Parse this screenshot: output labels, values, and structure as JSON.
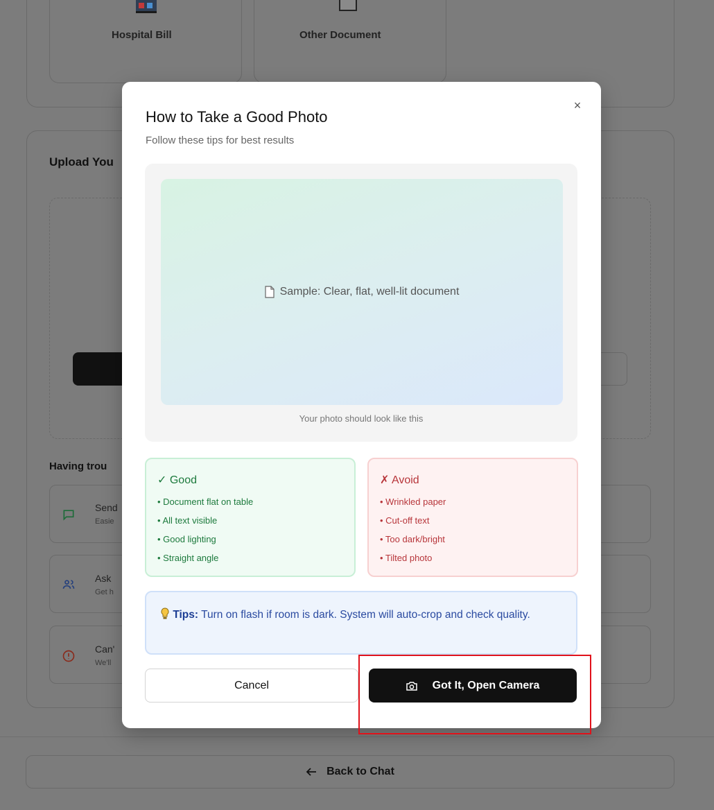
{
  "background": {
    "doc_types": [
      {
        "label": "Hospital Bill"
      },
      {
        "label": "Other Document"
      }
    ],
    "upload_heading": "Upload You",
    "trouble_heading": "Having trou",
    "help_options": [
      {
        "title": "Send",
        "subtitle": "Easie",
        "icon": "message-icon"
      },
      {
        "title": "Ask",
        "subtitle": "Get h",
        "icon": "users-icon"
      },
      {
        "title": "Can'",
        "subtitle": "We'll",
        "icon": "alert-circle-icon"
      }
    ],
    "back_button": {
      "label": "Back to Chat",
      "icon": "arrow-left-icon"
    }
  },
  "modal": {
    "title": "How to Take a Good Photo",
    "subtitle": "Follow these tips for best results",
    "close_label": "×",
    "sample": {
      "label": "Sample: Clear, flat, well-lit document",
      "caption": "Your photo should look like this"
    },
    "good": {
      "heading": "✓ Good",
      "items": [
        "• Document flat on table",
        "• All text visible",
        "• Good lighting",
        "• Straight angle"
      ]
    },
    "avoid": {
      "heading": "✗ Avoid",
      "items": [
        "• Wrinkled paper",
        "• Cut-off text",
        "• Too dark/bright",
        "• Tilted photo"
      ]
    },
    "tips": {
      "label": "Tips:",
      "text": "Turn on flash if room is dark. System will auto-crop and check quality."
    },
    "cancel_label": "Cancel",
    "confirm_label": "Got It, Open Camera"
  },
  "colors": {
    "overlay": "#7c7c7c",
    "good_text": "#1d7a3d",
    "avoid_text": "#b7353a",
    "tips_text": "#2a4aa0",
    "highlight": "#e0121b"
  }
}
